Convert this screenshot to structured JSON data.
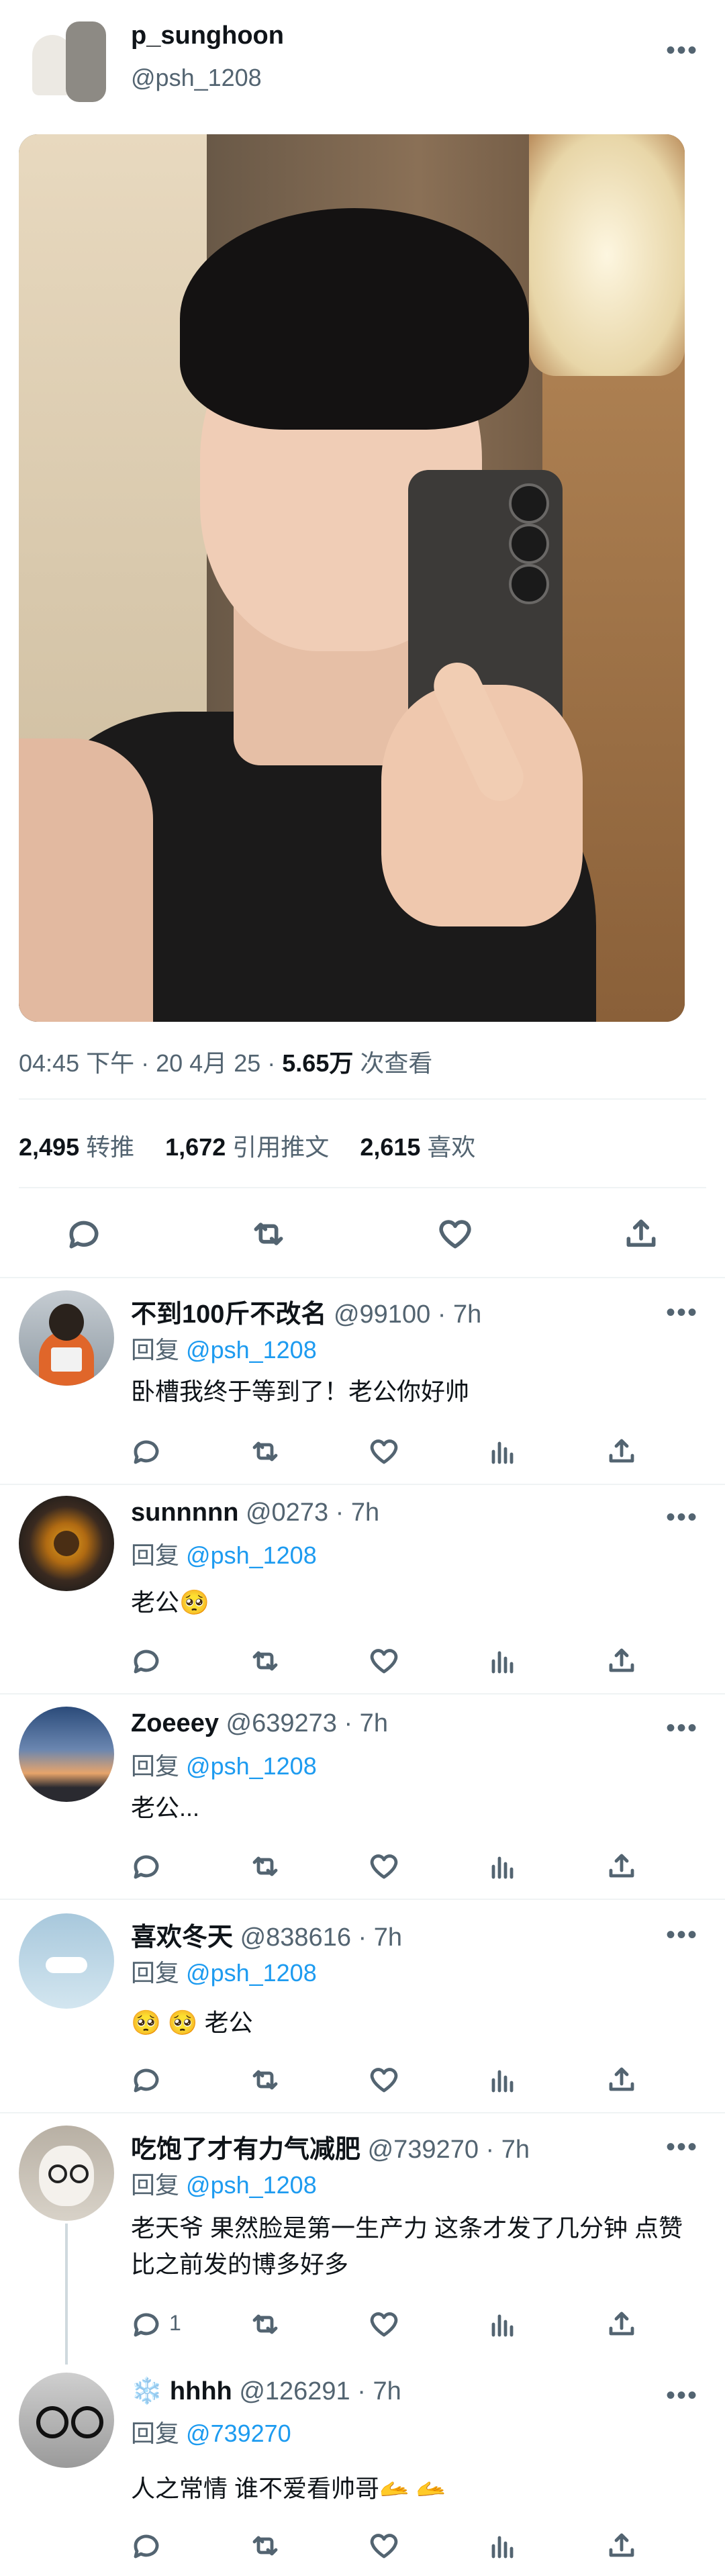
{
  "author": {
    "display_name": "p_sunghoon",
    "handle": "@psh_1208"
  },
  "tweet": {
    "time": "04:45 下午",
    "dot1": "·",
    "date": "20 4月 25",
    "dot2": "·",
    "views_num": "5.65万",
    "views_label": "次查看"
  },
  "stats": {
    "retweets_num": "2,495",
    "retweets_label": "转推",
    "quotes_num": "1,672",
    "quotes_label": "引用推文",
    "likes_num": "2,615",
    "likes_label": "喜欢"
  },
  "replies": [
    {
      "name": "不到100斤不改名",
      "handle": "@99100 · 7h",
      "reply_prefix": "回复",
      "reply_to": "@psh_1208",
      "text": "卧槽我终于等到了！老公你好帅",
      "reply_count": ""
    },
    {
      "name": "sunnnnn",
      "handle": "@0273 · 7h",
      "reply_prefix": "回复",
      "reply_to": "@psh_1208",
      "text": "老公🥺",
      "reply_count": ""
    },
    {
      "name": "Zoeeey",
      "handle": "@639273 · 7h",
      "reply_prefix": "回复",
      "reply_to": "@psh_1208",
      "text": "老公...",
      "reply_count": ""
    },
    {
      "name": "喜欢冬天",
      "handle": "@838616 · 7h",
      "reply_prefix": "回复",
      "reply_to": "@psh_1208",
      "text": "🥺 🥺 老公",
      "reply_count": ""
    },
    {
      "name": "吃饱了才有力气减肥",
      "handle": "@739270 · 7h",
      "reply_prefix": "回复",
      "reply_to": "@psh_1208",
      "text": "老天爷 果然脸是第一生产力 这条才发了几分钟 点赞比之前发的博多好多",
      "reply_count": "1"
    },
    {
      "name": "hhhh",
      "handle": "@126291 · 7h",
      "reply_prefix": "回复",
      "reply_to": "@739270",
      "text": "人之常情 谁不爱看帅哥🫴 🫴",
      "reply_count": ""
    }
  ],
  "colors": {
    "link": "#1d9bf0",
    "muted": "#536471",
    "text": "#0f1419"
  }
}
